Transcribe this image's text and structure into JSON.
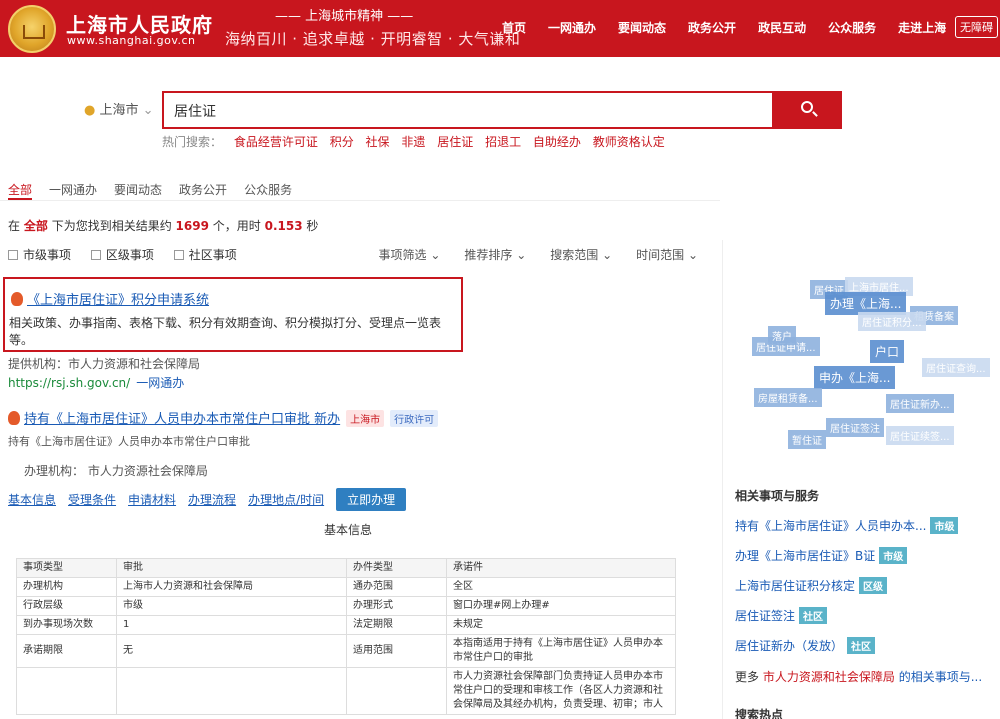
{
  "header": {
    "title": "上海市人民政府",
    "url": "www.shanghai.gov.cn",
    "slogan_top": "—— 上海城市精神 ——",
    "slogan_bottom": "海纳百川 · 追求卓越 · 开明睿智 · 大气谦和",
    "nav": [
      "首页",
      "一网通办",
      "要闻动态",
      "政务公开",
      "政民互动",
      "公众服务",
      "走进上海"
    ],
    "accessibility": "无障碍"
  },
  "search": {
    "location": "上海市",
    "query": "居住证",
    "hot_label": "热门搜索：",
    "hot_terms": [
      "食品经营许可证",
      "积分",
      "社保",
      "非遗",
      "居住证",
      "招退工",
      "自助经办",
      "教师资格认定"
    ]
  },
  "tabs": [
    "全部",
    "一网通办",
    "要闻动态",
    "政务公开",
    "公众服务"
  ],
  "result_count": {
    "prefix": "在",
    "scope": "全部",
    "mid": "下为您找到相关结果约",
    "count": "1699",
    "unit": "个，用时",
    "time": "0.153",
    "suffix": "秒"
  },
  "filters": {
    "options": [
      "市级事项",
      "区级事项",
      "社区事项"
    ],
    "sort": [
      "事项筛选 ⌄",
      "推荐排序 ⌄",
      "搜索范围 ⌄",
      "时间范围 ⌄"
    ]
  },
  "result1": {
    "title": "《上海市居住证》积分申请系统",
    "desc": "相关政策、办事指南、表格下载、积分有效期查询、积分模拟打分、受理点一览表等。",
    "provider": "提供机构：市人力资源和社会保障局",
    "url": "https://rsj.sh.gov.cn/",
    "url_tag": "一网通办"
  },
  "result2": {
    "title": "持有《上海市居住证》人员申办本市常住户口审批 新办",
    "tag_city": "上海市",
    "tag_type": "行政许可",
    "subtitle": "持有《上海市居住证》人员申办本市常住户口审批",
    "org": "办理机构：  市人力资源社会保障局",
    "links": [
      "基本信息",
      "受理条件",
      "申请材料",
      "办理流程",
      "办理地点/时间"
    ],
    "apply": "立即办理",
    "basic_info": "基本信息"
  },
  "info_table": [
    [
      "事项类型",
      "审批",
      "办件类型",
      "承诺件"
    ],
    [
      "办理机构",
      "上海市人力资源和社会保障局",
      "通办范围",
      "全区"
    ],
    [
      "行政层级",
      "市级",
      "办理形式",
      "窗口办理#网上办理#"
    ],
    [
      "到办事现场次数",
      "1",
      "法定期限",
      "未规定"
    ],
    [
      "承诺期限",
      "无",
      "适用范围",
      "本指南适用于持有《上海市居住证》人员申办本市常住户口的审批"
    ],
    [
      "",
      "",
      "",
      "市人力资源社会保障部门负责持证人员申办本市常住户口的受理和审核工作（各区人力资源和社会保障局及其经办机构，负责受理、初审；市人"
    ]
  ],
  "cloud": [
    "居住证",
    "上海市居住...",
    "办理《上海...",
    "租赁备案",
    "居住证积分...",
    "居住证申请...",
    "落户",
    "户口",
    "申办《上海...",
    "居住证查询...",
    "房屋租赁备...",
    "居住证新办...",
    "居住证签注",
    "居住证续签...",
    "暂住证"
  ],
  "related": {
    "title": "相关事项与服务",
    "items": [
      {
        "text": "持有《上海市居住证》人员申办本...",
        "badge": "市级"
      },
      {
        "text": "办理《上海市居住证》B证",
        "badge": "市级"
      },
      {
        "text": "上海市居住证积分核定",
        "badge": "区级"
      },
      {
        "text": "居住证签注",
        "badge": "社区"
      },
      {
        "text": "居住证新办（发放）",
        "badge": "社区"
      }
    ],
    "more_prefix": "更多",
    "more_org": "市人力资源和社会保障局",
    "more_suffix": "的相关事项与..."
  },
  "hot_search_title": "搜索热点"
}
